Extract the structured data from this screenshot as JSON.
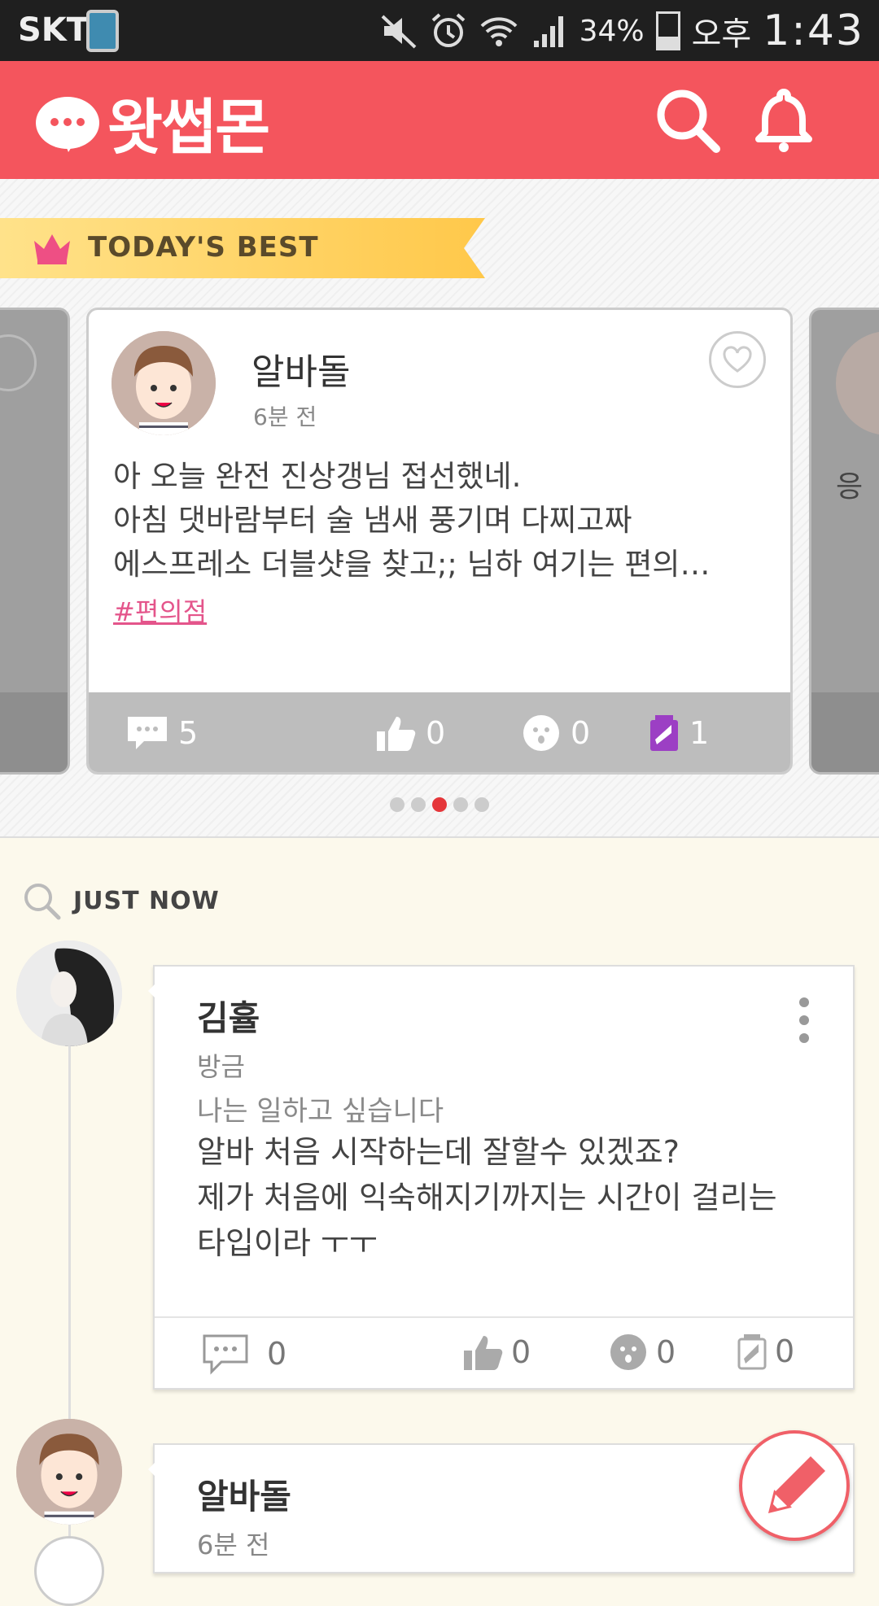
{
  "status_bar": {
    "carrier": "SKT",
    "battery": "34%",
    "ampm": "오후",
    "time": "1:43"
  },
  "header": {
    "logo_text": "왓썹몬",
    "brand_color": "#f4555d"
  },
  "best": {
    "ribbon_label": "TODAY'S BEST",
    "card": {
      "name": "알바돌",
      "time": "6분 전",
      "lines": [
        "아 오늘 완전 진상갱님 접선했네.",
        "아침 댓바람부터 술 냄새 풍기며 다찌고짜",
        "에스프레소 더블샷을 찾고;; 님하 여기는 편의…"
      ],
      "tag": "#편의점",
      "comments": "5",
      "likes": "0",
      "sad": "0",
      "energy": "1"
    },
    "right_peek_text": "응",
    "page_dots": 5,
    "active_dot": 3
  },
  "just_now": {
    "label": "JUST NOW",
    "post1": {
      "name": "김휼",
      "time": "방금",
      "subtitle": "나는 일하고 싶습니다",
      "body": [
        "알바 처음 시작하는데 잘할수 있겠죠?",
        "제가 처음에 익숙해지기까지는 시간이 걸리는",
        "타입이라 ㅜㅜ"
      ],
      "comments": "0",
      "likes": "0",
      "sad": "0",
      "energy": "0"
    },
    "post2": {
      "name": "알바돌",
      "time": "6분 전"
    }
  }
}
